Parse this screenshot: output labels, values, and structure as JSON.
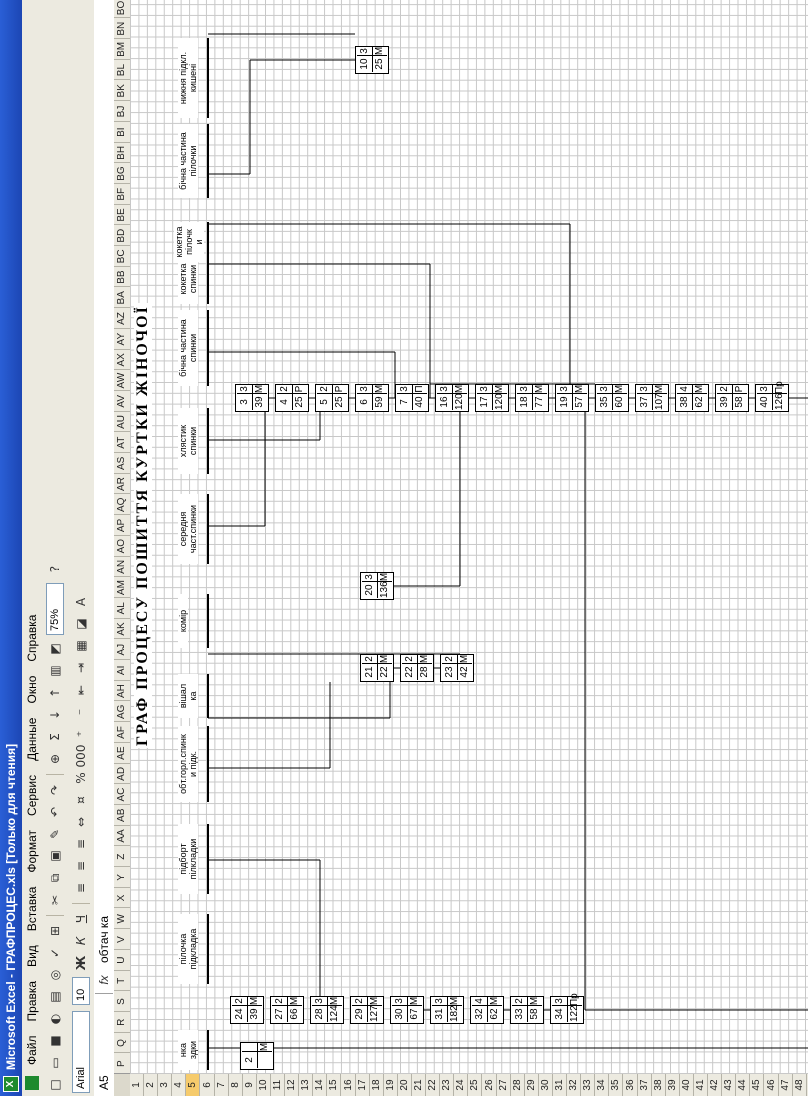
{
  "window": {
    "title": "Microsoft Excel - ГРАФПРОЦЕС.xls  [Только для чтения]"
  },
  "menu": [
    "Файл",
    "Правка",
    "Вид",
    "Вставка",
    "Формат",
    "Сервис",
    "Данные",
    "Окно",
    "Справка"
  ],
  "toolbar": {
    "zoom": "75%",
    "font": "Arial",
    "size": "10",
    "bold": "Ж",
    "italic": "К",
    "underline": "Ч",
    "percent": "%",
    "thousands": "000"
  },
  "formula_bar": {
    "name_box": "A5",
    "fx": "fx",
    "formula": "обтач ка"
  },
  "columns": [
    "P",
    "Q",
    "R",
    "S",
    "T",
    "U",
    "V",
    "W",
    "X",
    "Y",
    "Z",
    "AA",
    "AB",
    "AC",
    "AD",
    "AE",
    "AF",
    "AG",
    "AH",
    "AI",
    "AJ",
    "AK",
    "AL",
    "AM",
    "AN",
    "AO",
    "AP",
    "AQ",
    "AR",
    "AS",
    "AT",
    "AU",
    "AV",
    "AW",
    "AX",
    "AY",
    "AZ",
    "BA",
    "BB",
    "BC",
    "BD",
    "BE",
    "BF",
    "BG",
    "BH",
    "BI",
    "BJ",
    "BK",
    "BL",
    "BM",
    "BN",
    "BO"
  ],
  "rows": [
    "1",
    "2",
    "3",
    "4",
    "5",
    "6",
    "7",
    "8",
    "9",
    "10",
    "11",
    "12",
    "13",
    "14",
    "15",
    "16",
    "17",
    "18",
    "19",
    "20",
    "21",
    "22",
    "23",
    "24",
    "25",
    "26",
    "27",
    "28",
    "29",
    "30",
    "31",
    "32",
    "33",
    "34",
    "35",
    "36",
    "37",
    "38",
    "39",
    "40",
    "41",
    "42",
    "43",
    "44",
    "45",
    "46",
    "47",
    "48"
  ],
  "sheet": {
    "title": "ГРАФ  ПРОЦЕСУ  ПОШИТТЯ  КУРТКИ  ЖІНОЧОЇ",
    "headers": [
      "нка\nздки",
      "пілочка\nпідкладка",
      "підборт\nпілкладки",
      "обт.горл.спинк\nи підк.",
      "вішал\nка",
      "комір",
      "середня\nчаст.спинки",
      "хлястик\nспинки",
      "бічна частина\nспинки",
      "кокетка\nспинки",
      "кокетка\nпілочк\nи",
      "бічна частина\nпілочки",
      "нижня підкл.\nкишені"
    ],
    "ops": [
      {
        "n": "2",
        "c": "",
        "t": "",
        "k": "М"
      },
      {
        "n": "24",
        "c": "2",
        "t": "39",
        "k": "М"
      },
      {
        "n": "27",
        "c": "2",
        "t": "66",
        "k": "М"
      },
      {
        "n": "28",
        "c": "3",
        "t": "124",
        "k": "М"
      },
      {
        "n": "29",
        "c": "2",
        "t": "127",
        "k": "М"
      },
      {
        "n": "30",
        "c": "3",
        "t": "67",
        "k": "М"
      },
      {
        "n": "31",
        "c": "3",
        "t": "182",
        "k": "М"
      },
      {
        "n": "32",
        "c": "4",
        "t": "62",
        "k": "М"
      },
      {
        "n": "33",
        "c": "2",
        "t": "58",
        "k": "М"
      },
      {
        "n": "34",
        "c": "3",
        "t": "122",
        "k": "Пр"
      },
      {
        "n": "21",
        "c": "2",
        "t": "22",
        "k": "М"
      },
      {
        "n": "22",
        "c": "2",
        "t": "28",
        "k": "М"
      },
      {
        "n": "23",
        "c": "2",
        "t": "42",
        "k": "М"
      },
      {
        "n": "20",
        "c": "3",
        "t": "136",
        "k": "М"
      },
      {
        "n": "3",
        "c": "3",
        "t": "39",
        "k": "М"
      },
      {
        "n": "4",
        "c": "2",
        "t": "25",
        "k": "Р"
      },
      {
        "n": "5",
        "c": "2",
        "t": "25",
        "k": "Р"
      },
      {
        "n": "6",
        "c": "3",
        "t": "59",
        "k": "М"
      },
      {
        "n": "7",
        "c": "3",
        "t": "40",
        "k": "П"
      },
      {
        "n": "16",
        "c": "3",
        "t": "120",
        "k": "М"
      },
      {
        "n": "17",
        "c": "3",
        "t": "120",
        "k": "М"
      },
      {
        "n": "18",
        "c": "3",
        "t": "77",
        "k": "М"
      },
      {
        "n": "19",
        "c": "3",
        "t": "57",
        "k": "М"
      },
      {
        "n": "35",
        "c": "3",
        "t": "60",
        "k": "М"
      },
      {
        "n": "37",
        "c": "3",
        "t": "107",
        "k": "М"
      },
      {
        "n": "38",
        "c": "4",
        "t": "62",
        "k": "М"
      },
      {
        "n": "39",
        "c": "2",
        "t": "58",
        "k": "Р"
      },
      {
        "n": "40",
        "c": "3",
        "t": "126",
        "k": "Пр"
      },
      {
        "n": "10",
        "c": "3",
        "t": "25",
        "k": "М"
      }
    ]
  }
}
